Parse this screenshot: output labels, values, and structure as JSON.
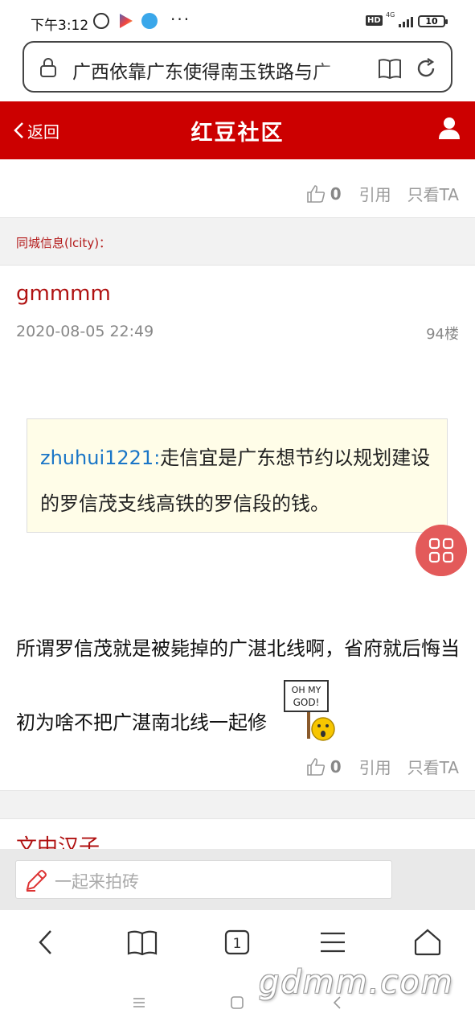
{
  "status_bar": {
    "time": "下午3:12",
    "more": "···",
    "hd": "HD",
    "network": "4G",
    "battery": "10"
  },
  "url_bar": {
    "url_text": "广西依靠广东使得南玉铁路与广"
  },
  "header": {
    "back_label": "返回",
    "site_title": "红豆社区",
    "accent_color": "#cc0000"
  },
  "prev_post_actions": {
    "like_count": "0",
    "quote_label": "引用",
    "only_ta_label": "只看TA"
  },
  "source": {
    "text": "同城信息(lcity)："
  },
  "post": {
    "author": "gmmmm",
    "time": "2020-08-05 22:49",
    "floor": "94楼",
    "quote": {
      "user": "zhuhui1221:",
      "text": "走信宜是广东想节约以规划建设的罗信茂支线高铁的罗信段的钱。"
    },
    "body": "所谓罗信茂就是被毙掉的广湛北线啊，省府就后悔当初为啥不把广湛南北线一起修",
    "emoji": {
      "icon": "oh-my-god-sign-emoji",
      "sign_line1": "OH MY",
      "sign_line2": "GOD!"
    },
    "actions": {
      "like_count": "0",
      "quote_label": "引用",
      "only_ta_label": "只看TA"
    }
  },
  "next_post": {
    "author": "文中汉子"
  },
  "compose": {
    "placeholder": "一起来拍砖"
  },
  "watermark": "gdmm.com",
  "browser_nav": {
    "tab_count": "1"
  }
}
